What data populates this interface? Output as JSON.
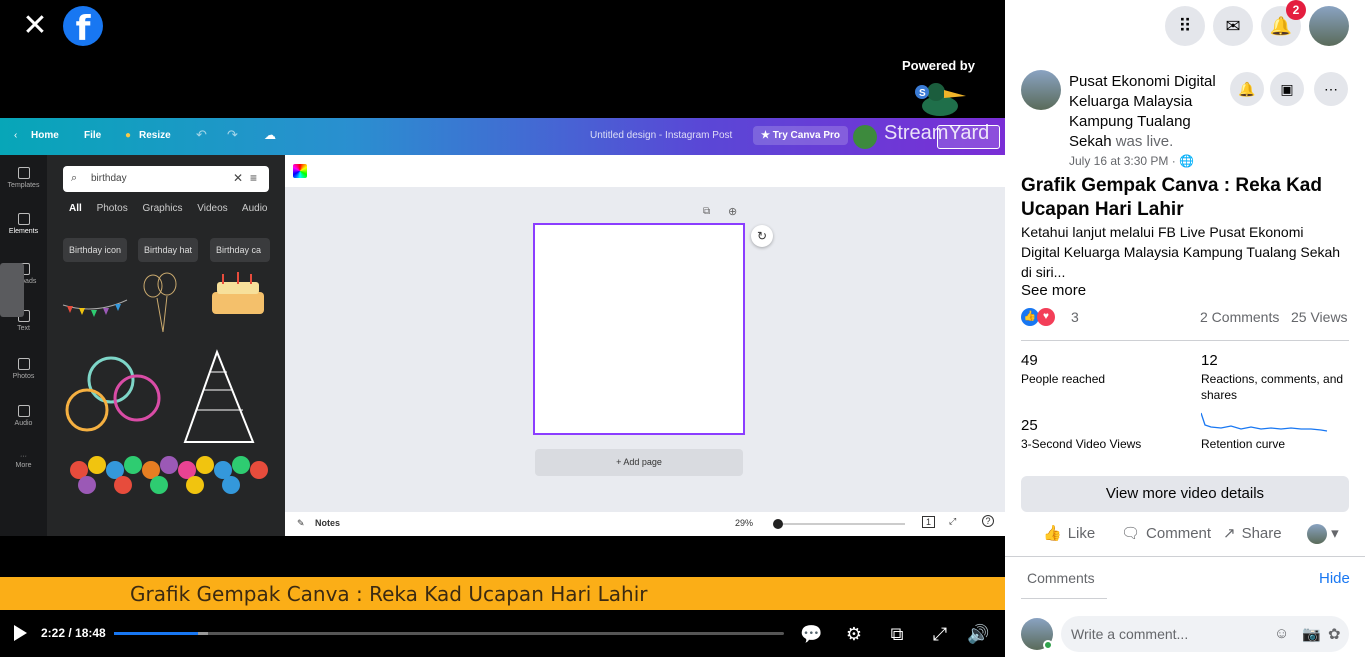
{
  "video": {
    "powered_by": "Powered by",
    "streamyard_text": "StreamYard",
    "caption": "Grafik Gempak Canva : Reka Kad Ucapan Hari Lahir",
    "time": "2:22 / 18:48",
    "progress": 0.126
  },
  "canva": {
    "home": "Home",
    "file": "File",
    "resize": "Resize",
    "doc_title": "Untitled design - Instagram Post",
    "try_pro": "Try Canva Pro",
    "search_value": "birthday",
    "tabs": [
      "All",
      "Photos",
      "Graphics",
      "Videos",
      "Audio"
    ],
    "chips": [
      "Birthday icon",
      "Birthday hat",
      "Birthday ca"
    ],
    "rail": [
      "Templates",
      "Elements",
      "Uploads",
      "Text",
      "Photos",
      "Audio",
      "More"
    ],
    "add_page": "+ Add page",
    "notes": "Notes",
    "zoom": "29%",
    "page_num": "1"
  },
  "side": {
    "notif_count": "2",
    "page_name": "Pusat Ekonomi Digital Keluarga Malaysia Kampung Tualang Sekah",
    "was_live": "was live.",
    "date": "July 16 at 3:30 PM · ",
    "title": "Grafik Gempak Canva : Reka Kad Ucapan Hari Lahir",
    "description": "Ketahui lanjut melalui FB Live Pusat Ekonomi Digital Keluarga Malaysia Kampung Tualang Sekah di siri...",
    "see_more": "See more",
    "reaction_count": "3",
    "comments_count": "2 Comments",
    "views_count": "25 Views",
    "stats": {
      "reached_num": "49",
      "reached_label": "People reached",
      "engage_num": "12",
      "engage_label": "Reactions, comments, and shares",
      "views3_num": "25",
      "views3_label": "3-Second Video Views",
      "retention_label": "Retention curve"
    },
    "view_more": "View more video details",
    "actions": {
      "like": "Like",
      "comment": "Comment",
      "share": "Share"
    },
    "comments_header": "Comments",
    "hide": "Hide",
    "comment_placeholder": "Write a comment..."
  }
}
